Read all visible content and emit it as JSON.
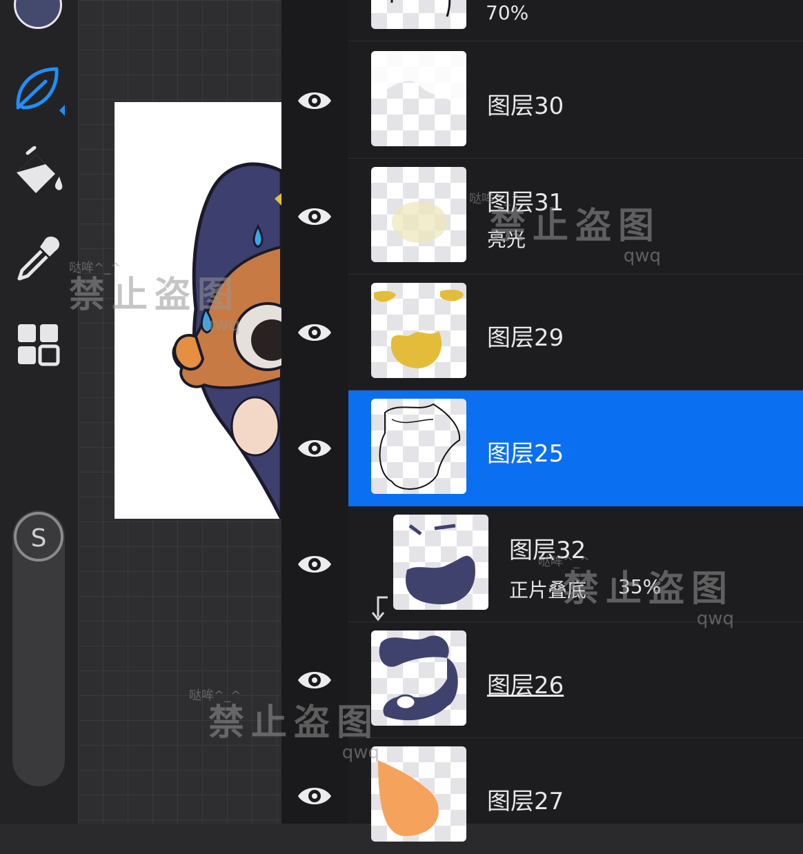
{
  "toolbar": {
    "brush_color": "#444a6e",
    "tools": [
      {
        "name": "brush",
        "icon": "leaf-brush-icon",
        "active": true
      },
      {
        "name": "fill",
        "icon": "paint-bucket-icon",
        "active": false
      },
      {
        "name": "eyedropper",
        "icon": "eyedropper-icon",
        "active": false
      },
      {
        "name": "layers",
        "icon": "grid-icon",
        "active": false
      }
    ],
    "size_slider_label": "S"
  },
  "layers": [
    {
      "name": "",
      "sub": "70%",
      "visible": true,
      "selected": false
    },
    {
      "name": "图层30",
      "sub": "",
      "visible": true,
      "selected": false
    },
    {
      "name": "图层31",
      "sub": "亮光",
      "visible": true,
      "selected": false
    },
    {
      "name": "图层29",
      "sub": "",
      "visible": true,
      "selected": false
    },
    {
      "name": "图层25",
      "sub": "",
      "visible": true,
      "selected": true
    },
    {
      "name": "图层32",
      "sub": "正片叠底",
      "opacity": "35%",
      "visible": true,
      "selected": false,
      "clipped": true
    },
    {
      "name": "图层26",
      "sub": "",
      "visible": true,
      "selected": false
    },
    {
      "name": "图层27",
      "sub": "",
      "visible": true,
      "selected": false
    }
  ],
  "watermarks": [
    {
      "small": "哒哞^_^",
      "big": "禁止盗图",
      "tag": "qwq"
    },
    {
      "small": "哒哞^_^",
      "big": "禁止盗图",
      "tag": "qwq"
    },
    {
      "small": "哒哞^_^",
      "big": "禁止盗图",
      "tag": "qwq"
    },
    {
      "small": "哒哞^_^",
      "big": "禁止盗图",
      "tag": "qwq"
    }
  ],
  "colors": {
    "selection": "#0a6ff0",
    "active_tool": "#1e90ff",
    "panel": "#1d1d20"
  }
}
